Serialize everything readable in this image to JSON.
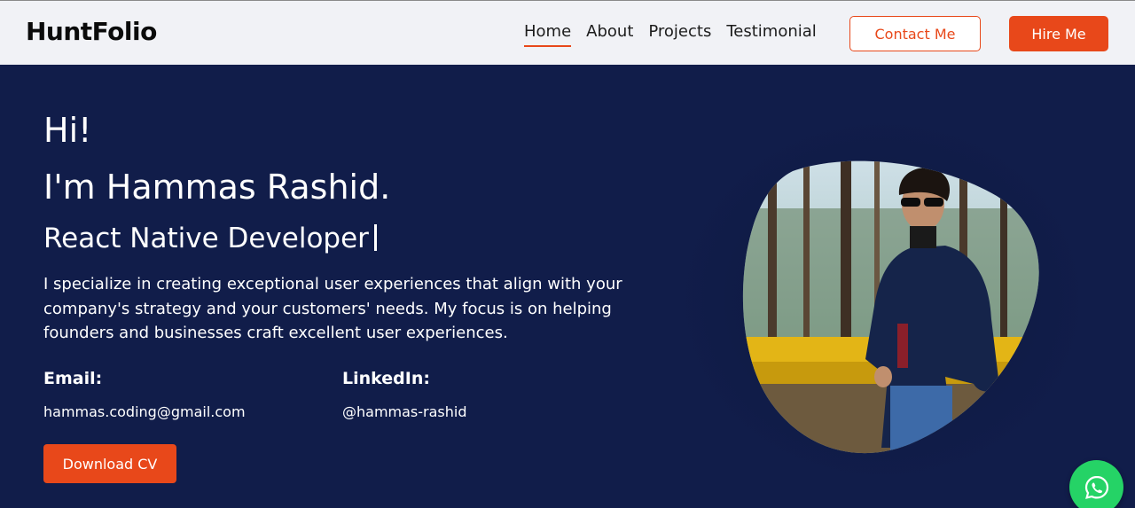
{
  "brand": {
    "logo": "HuntFolio"
  },
  "nav": {
    "links": [
      "Home",
      "About",
      "Projects",
      "Testimonial"
    ],
    "active": "Home",
    "contact_label": "Contact Me",
    "hire_label": "Hire Me"
  },
  "hero": {
    "greeting": "Hi!",
    "name": "I'm Hammas Rashid.",
    "role": "React Native Developer",
    "bio": "I specialize in creating exceptional user experiences that align with your company's strategy and your customers' needs. My focus is on helping founders and businesses craft excellent user experiences.",
    "email_label": "Email:",
    "email": "hammas.coding@gmail.com",
    "linkedin_label": "LinkedIn:",
    "linkedin": "@hammas-rashid",
    "download_label": "Download CV"
  },
  "colors": {
    "accent": "#e8481a",
    "hero_bg": "#111d4a",
    "nav_bg": "#f1f2f6",
    "whatsapp": "#25d366"
  },
  "icons": {
    "floating": "whatsapp-icon"
  }
}
